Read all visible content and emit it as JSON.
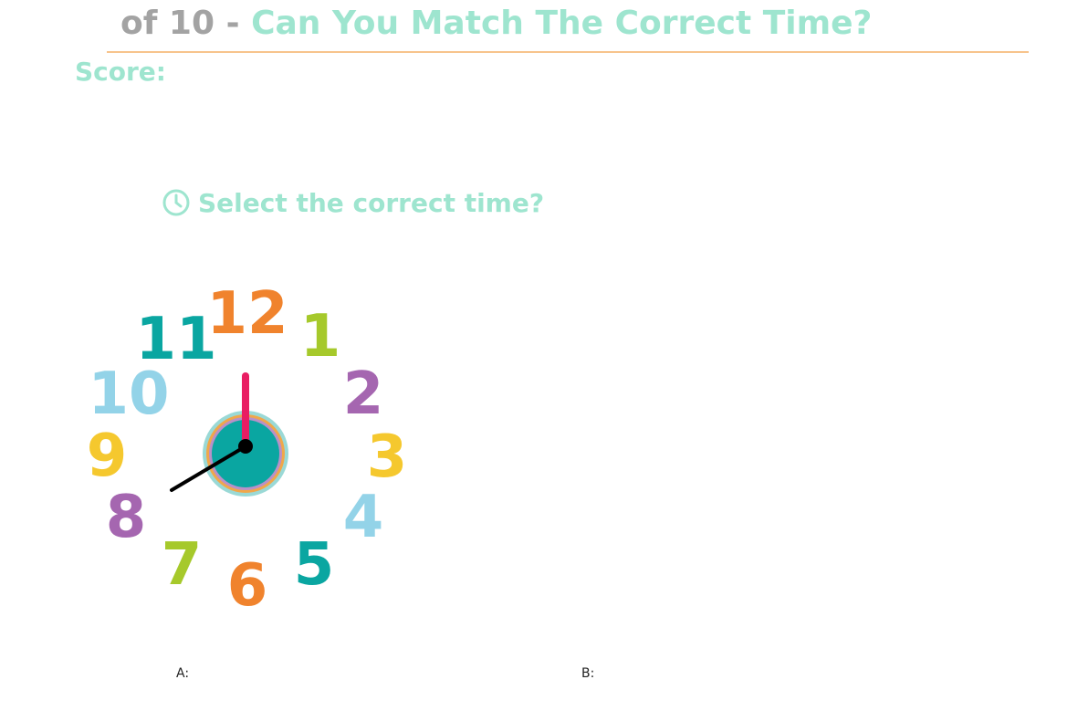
{
  "header": {
    "progress_text": "of 10",
    "separator": "-",
    "title": "Can You Match The Correct Time?"
  },
  "score": {
    "label": "Score:"
  },
  "question": {
    "icon": "clock-icon",
    "text": "Select the correct time?"
  },
  "clock_face": {
    "numbers": [
      "12",
      "1",
      "2",
      "3",
      "4",
      "5",
      "6",
      "7",
      "8",
      "9",
      "10",
      "11"
    ],
    "hour_hand_points_to": "8",
    "minute_hand_points_to": "12",
    "colors": {
      "hour_hand": "#000000",
      "minute_hand": "#e91e63",
      "center": "#0aa6a1"
    }
  },
  "options": [
    {
      "label": "A:"
    },
    {
      "label": "B:"
    }
  ],
  "colors": {
    "accent": "#9ee5cf",
    "muted": "#a3a3a3",
    "rule": "#f7c48c"
  }
}
